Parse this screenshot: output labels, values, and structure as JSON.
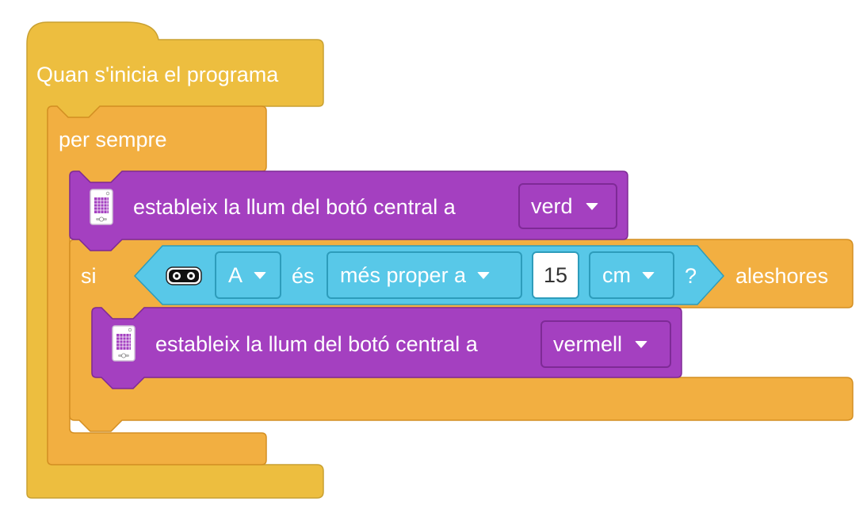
{
  "colors": {
    "events": "#EDBE3F",
    "events_border": "#C9A132",
    "control": "#F2AF41",
    "control_border": "#D48F22",
    "light": "#A440C0",
    "light_border": "#7E2A96",
    "sensor": "#58C8E8",
    "sensor_border": "#2D9CBB"
  },
  "hat_block": {
    "label": "Quan s'inicia el programa"
  },
  "forever_block": {
    "label": "per sempre"
  },
  "light_block_1": {
    "label": "estableix la llum del botó central a",
    "color_value": "verd",
    "icon": "hub-icon"
  },
  "if_block": {
    "label_if": "si",
    "label_then": "aleshores",
    "condition": {
      "icon": "distance-sensor-icon",
      "port": "A",
      "word_is": "és",
      "comparison": "més proper a",
      "value": "15",
      "unit": "cm",
      "question": "?"
    }
  },
  "light_block_2": {
    "label": "estableix la llum del botó central a",
    "color_value": "vermell",
    "icon": "hub-icon"
  }
}
